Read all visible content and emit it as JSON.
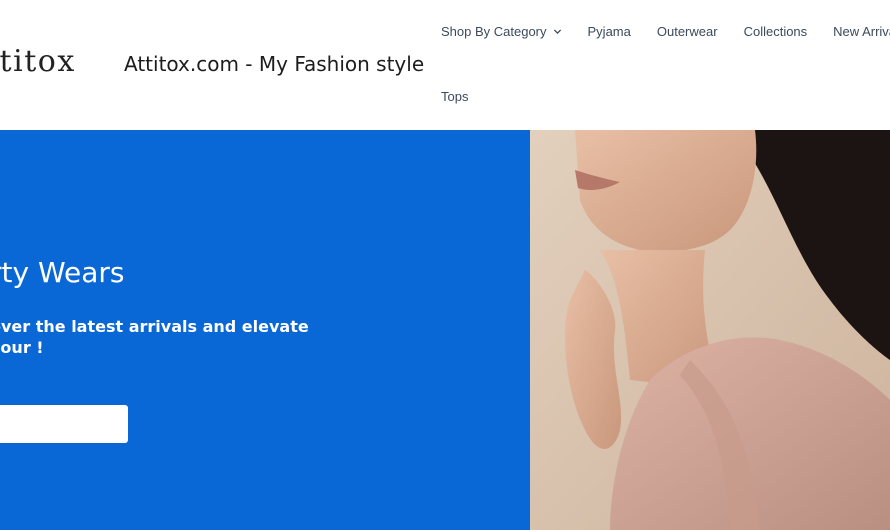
{
  "header": {
    "logo_text": "ttitox",
    "site_title": "Attitox.com - My Fashion style"
  },
  "nav": {
    "items": [
      {
        "label": "Shop By Category",
        "has_dropdown": true
      },
      {
        "label": "Pyjama"
      },
      {
        "label": "Outerwear"
      },
      {
        "label": "Collections"
      },
      {
        "label": "New Arrivals"
      }
    ],
    "second_row": [
      {
        "label": "Tops"
      }
    ]
  },
  "hero": {
    "heading": "rty Wears",
    "subtext": "over the latest arrivals and elevate your !",
    "button_label": "",
    "image_icon": "model-portrait-photo",
    "colors": {
      "panel": "#0a67d6",
      "photo_bg": "#d9c5b1"
    }
  }
}
